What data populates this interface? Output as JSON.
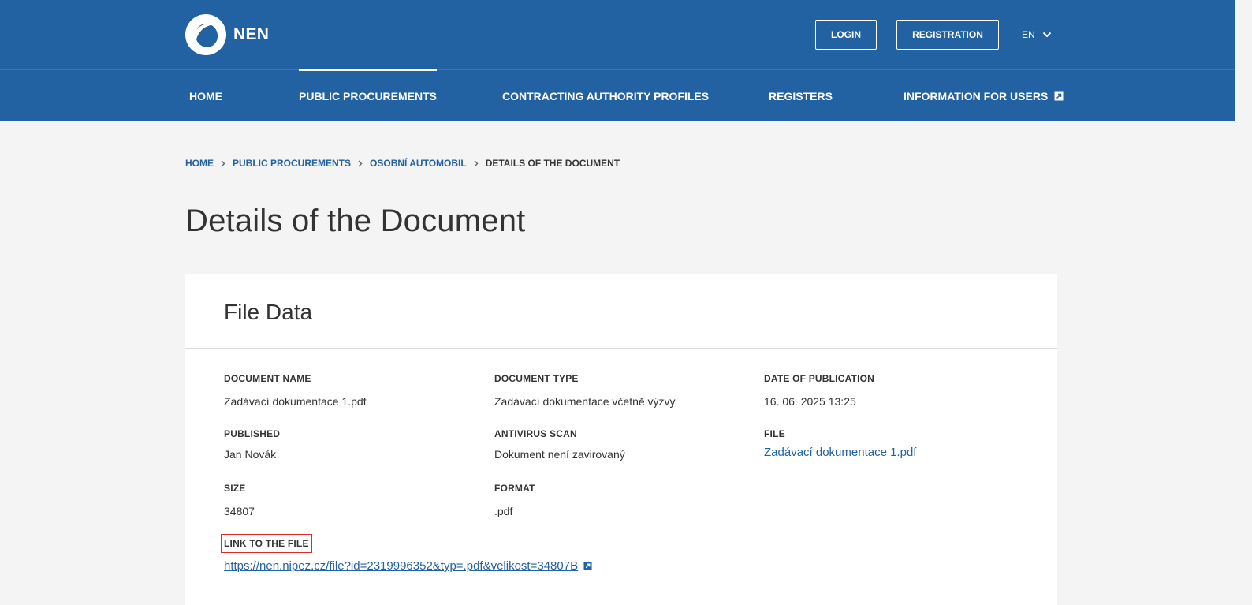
{
  "header": {
    "logo_text": "NEN",
    "login_label": "LOGIN",
    "registration_label": "REGISTRATION",
    "language": "EN"
  },
  "nav": {
    "items": [
      {
        "label": "HOME"
      },
      {
        "label": "PUBLIC PROCUREMENTS"
      },
      {
        "label": "CONTRACTING AUTHORITY PROFILES"
      },
      {
        "label": "REGISTERS"
      },
      {
        "label": "INFORMATION FOR USERS"
      }
    ]
  },
  "breadcrumb": {
    "items": [
      "HOME",
      "PUBLIC PROCUREMENTS",
      "OSOBNÍ AUTOMOBIL"
    ],
    "current": "DETAILS OF THE DOCUMENT"
  },
  "page": {
    "title": "Details of the Document"
  },
  "card": {
    "title": "File Data",
    "fields": {
      "document_name": {
        "label": "DOCUMENT NAME",
        "value": "Zadávací dokumentace 1.pdf"
      },
      "document_type": {
        "label": "DOCUMENT TYPE",
        "value": "Zadávací dokumentace včetně výzvy"
      },
      "date_of_publication": {
        "label": "DATE OF PUBLICATION",
        "value": "16. 06. 2025 13:25"
      },
      "published": {
        "label": "PUBLISHED",
        "value": "Jan Novák"
      },
      "antivirus_scan": {
        "label": "ANTIVIRUS SCAN",
        "value": "Dokument není zavirovaný"
      },
      "file": {
        "label": "FILE",
        "value": "Zadávací dokumentace 1.pdf"
      },
      "size": {
        "label": "SIZE",
        "value": "34807"
      },
      "format": {
        "label": "FORMAT",
        "value": ".pdf"
      },
      "link_to_file": {
        "label": "LINK TO THE FILE",
        "value": "https://nen.nipez.cz/file?id=2319996352&typ=.pdf&velikost=34807B"
      }
    }
  },
  "colors": {
    "brand": "#2362a2",
    "background": "#f4f4f4",
    "highlight": "#e3262a"
  }
}
